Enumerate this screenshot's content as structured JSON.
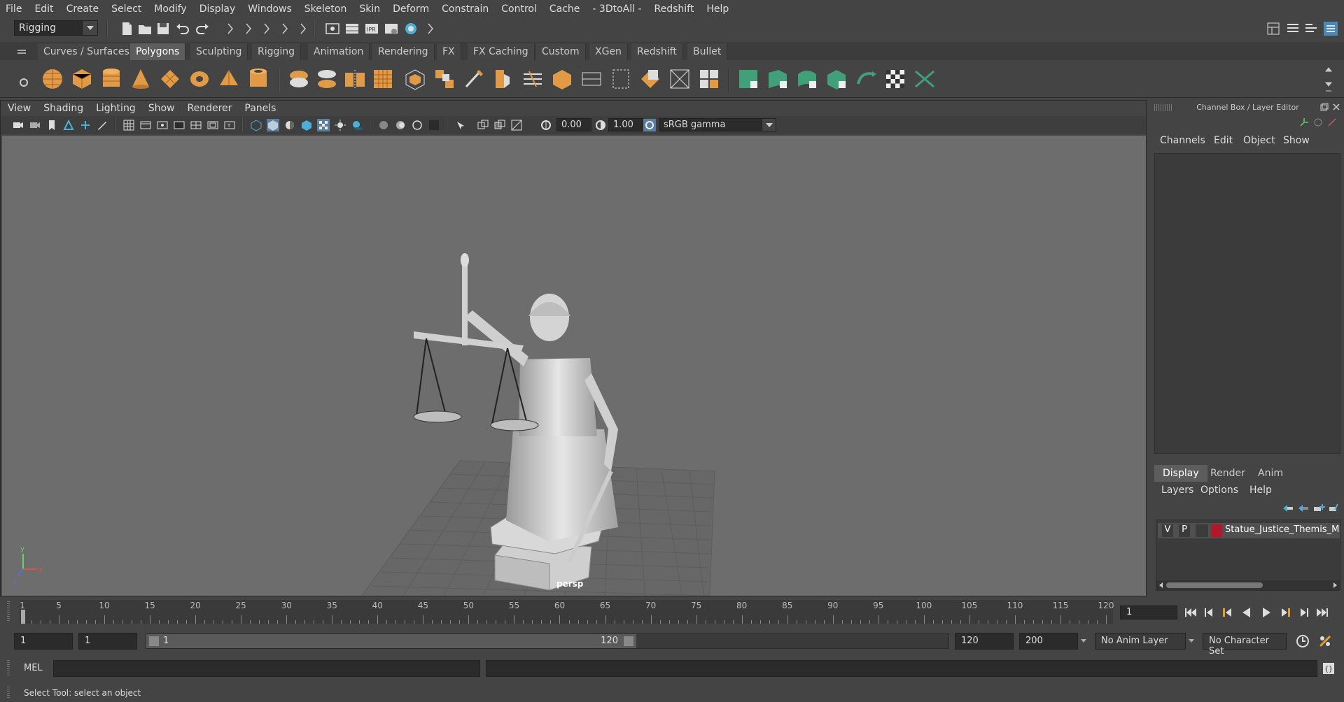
{
  "menubar": {
    "items": [
      "File",
      "Edit",
      "Create",
      "Select",
      "Modify",
      "Display",
      "Windows",
      "Skeleton",
      "Skin",
      "Deform",
      "Constrain",
      "Control",
      "Cache",
      "- 3DtoAll -",
      "Redshift",
      "Help"
    ]
  },
  "statusline": {
    "menuset": "Rigging"
  },
  "shelf": {
    "tabs": [
      "Curves / Surfaces",
      "Polygons",
      "Sculpting",
      "Rigging",
      "Animation",
      "Rendering",
      "FX",
      "FX Caching",
      "Custom",
      "XGen",
      "Redshift",
      "Bullet"
    ],
    "active_tab": "Polygons",
    "icons": [
      "poly-sphere-icon",
      "poly-cube-icon",
      "poly-cylinder-icon",
      "poly-cone-icon",
      "poly-plane-icon",
      "poly-torus-icon",
      "poly-pyramid-icon",
      "poly-pipe-icon",
      "combine-icon",
      "separate-icon",
      "mirror-icon",
      "smooth-icon",
      "extrude-icon",
      "bridge-icon",
      "multicut-icon",
      "bevel-icon",
      "fill-hole-icon",
      "target-weld-icon",
      "merge-icon",
      "uv-editor-icon",
      "planar-uv-icon",
      "automatic-uv-icon",
      "cut-uv-icon",
      "sew-uv-icon",
      "unfold-icon",
      "layout-uv-icon",
      "checker-icon",
      "uv-transfer-icon"
    ]
  },
  "viewport": {
    "menu": [
      "View",
      "Shading",
      "Lighting",
      "Show",
      "Renderer",
      "Panels"
    ],
    "exposure": "0.00",
    "gamma": "1.00",
    "color_space": "sRGB gamma",
    "camera_label": "persp",
    "axis": {
      "x": "x",
      "y": "y",
      "z": "z"
    }
  },
  "channelbox": {
    "title": "Channel Box / Layer Editor",
    "menu": [
      "Channels",
      "Edit",
      "Object",
      "Show"
    ]
  },
  "layer_editor": {
    "tabs": [
      "Display",
      "Render",
      "Anim"
    ],
    "active_tab": "Display",
    "menu": [
      "Layers",
      "Options",
      "Help"
    ],
    "layer": {
      "v": "V",
      "p": "P",
      "name": "Statue_Justice_Themis_M",
      "color": "#b0182c"
    }
  },
  "timeline": {
    "ticks": [
      "1",
      "5",
      "10",
      "15",
      "20",
      "25",
      "30",
      "35",
      "40",
      "45",
      "50",
      "55",
      "60",
      "65",
      "70",
      "75",
      "80",
      "85",
      "90",
      "95",
      "100",
      "105",
      "110",
      "115",
      "120"
    ],
    "current_frame": "1"
  },
  "range": {
    "start": "1",
    "playback_start": "1",
    "slider_start": "1",
    "slider_end": "120",
    "playback_end": "120",
    "end": "200",
    "anim_layer": "No Anim Layer",
    "character_set": "No Character Set"
  },
  "cmdline": {
    "label": "MEL"
  },
  "helpline": {
    "text": "Select Tool: select an object"
  }
}
